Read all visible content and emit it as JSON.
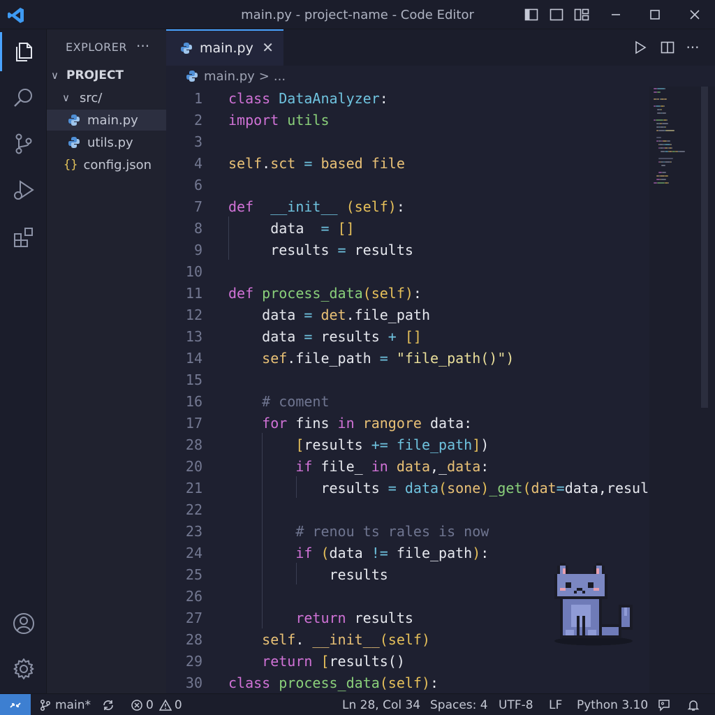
{
  "window": {
    "title": "main.py - project-name - Code Editor"
  },
  "sidebar": {
    "header": "EXPLORER",
    "more_label": "···",
    "tree": [
      {
        "label": "PROJECT",
        "chevron": "∨"
      },
      {
        "label": "src/",
        "chevron": "∨"
      },
      {
        "label": "main.py",
        "icon": "python-file-icon",
        "selected": true
      },
      {
        "label": "utils.py",
        "icon": "python-file-icon"
      },
      {
        "label": "config.json",
        "icon": "json-file-icon",
        "icon_glyph": "{}"
      }
    ]
  },
  "tabs": [
    {
      "label": "main.py",
      "active": true,
      "close": "✕"
    }
  ],
  "breadcrumb": {
    "file": "main.py",
    "separator": ">",
    "rest": "..."
  },
  "editor": {
    "lines": [
      {
        "n": "1",
        "tokens": [
          [
            "kw",
            "class "
          ],
          [
            "cls",
            "DataAnalyzer"
          ],
          [
            "txt",
            ":"
          ]
        ]
      },
      {
        "n": "2",
        "tokens": [
          [
            "kw",
            "import "
          ],
          [
            "fn",
            "utils"
          ]
        ]
      },
      {
        "n": "3",
        "tokens": []
      },
      {
        "n": "4",
        "tokens": [
          [
            "var",
            "self"
          ],
          [
            "txt",
            "."
          ],
          [
            "var",
            "sct"
          ],
          [
            "op",
            " = "
          ],
          [
            "var",
            "based "
          ],
          [
            "var",
            "file"
          ]
        ]
      },
      {
        "n": "6",
        "tokens": []
      },
      {
        "n": "7",
        "tokens": [
          [
            "kw",
            "def  "
          ],
          [
            "cls",
            "__init__ "
          ],
          [
            "par",
            "(self)"
          ],
          [
            "txt",
            ":"
          ]
        ]
      },
      {
        "n": "8",
        "tokens": [
          [
            "txt",
            "     data  "
          ],
          [
            "op",
            "= "
          ],
          [
            "par",
            "[]"
          ]
        ]
      },
      {
        "n": "9",
        "tokens": [
          [
            "txt",
            "     results "
          ],
          [
            "op",
            "= "
          ],
          [
            "txt",
            "results"
          ]
        ]
      },
      {
        "n": "10",
        "tokens": []
      },
      {
        "n": "11",
        "tokens": [
          [
            "kw",
            "def "
          ],
          [
            "fn",
            "process_data"
          ],
          [
            "par",
            "(self)"
          ],
          [
            "txt",
            ":"
          ]
        ]
      },
      {
        "n": "12",
        "tokens": [
          [
            "txt",
            "    data "
          ],
          [
            "op",
            "= "
          ],
          [
            "var",
            "det"
          ],
          [
            "txt",
            ".file_path"
          ]
        ]
      },
      {
        "n": "13",
        "tokens": [
          [
            "txt",
            "    data "
          ],
          [
            "op",
            "= "
          ],
          [
            "txt",
            "results "
          ],
          [
            "op",
            "+ "
          ],
          [
            "par",
            "[]"
          ]
        ]
      },
      {
        "n": "14",
        "tokens": [
          [
            "var",
            "    sef"
          ],
          [
            "txt",
            ".file_path "
          ],
          [
            "op",
            "= "
          ],
          [
            "str",
            "\"file_path()\")"
          ]
        ]
      },
      {
        "n": "15",
        "tokens": []
      },
      {
        "n": "16",
        "tokens": [
          [
            "cm",
            "    # coment"
          ]
        ]
      },
      {
        "n": "17",
        "tokens": [
          [
            "kw",
            "    for "
          ],
          [
            "txt",
            "fins "
          ],
          [
            "kw",
            "in "
          ],
          [
            "var",
            "rangore "
          ],
          [
            "txt",
            "data:"
          ]
        ]
      },
      {
        "n": "28",
        "tokens": [
          [
            "par",
            "        ["
          ],
          [
            "txt",
            "results "
          ],
          [
            "op",
            "+= "
          ],
          [
            "cls",
            "file_path"
          ],
          [
            "par",
            "]"
          ],
          [
            "txt",
            ")"
          ]
        ]
      },
      {
        "n": "20",
        "tokens": [
          [
            "kw",
            "        if "
          ],
          [
            "txt",
            "file_ "
          ],
          [
            "kw",
            "in "
          ],
          [
            "var",
            "data"
          ],
          [
            "txt",
            ",_"
          ],
          [
            "var",
            "data"
          ],
          [
            "txt",
            ":"
          ]
        ]
      },
      {
        "n": "21",
        "tokens": [
          [
            "txt",
            "           results "
          ],
          [
            "op",
            "= "
          ],
          [
            "cls",
            "data"
          ],
          [
            "par",
            "("
          ],
          [
            "var",
            "sone"
          ],
          [
            "par",
            ")"
          ],
          [
            "fn",
            "_get"
          ],
          [
            "par",
            "("
          ],
          [
            "var",
            "dat"
          ],
          [
            "op",
            "="
          ],
          [
            "txt",
            "data,resul"
          ]
        ]
      },
      {
        "n": "22",
        "tokens": []
      },
      {
        "n": "23",
        "tokens": [
          [
            "cm",
            "        # renou ts rales is now"
          ]
        ]
      },
      {
        "n": "24",
        "tokens": [
          [
            "kw",
            "        if "
          ],
          [
            "par",
            "("
          ],
          [
            "txt",
            "data "
          ],
          [
            "op",
            "!= "
          ],
          [
            "txt",
            "file_path"
          ],
          [
            "par",
            ")"
          ],
          [
            "txt",
            ":"
          ]
        ]
      },
      {
        "n": "25",
        "tokens": [
          [
            "txt",
            "            results"
          ]
        ]
      },
      {
        "n": "26",
        "tokens": []
      },
      {
        "n": "27",
        "tokens": [
          [
            "kw",
            "        return "
          ],
          [
            "txt",
            "results"
          ]
        ]
      },
      {
        "n": "28",
        "tokens": [
          [
            "var",
            "    self"
          ],
          [
            "txt",
            ". "
          ],
          [
            "var",
            "__init__"
          ],
          [
            "par",
            "(self)"
          ]
        ]
      },
      {
        "n": "29",
        "tokens": [
          [
            "kw",
            "    return "
          ],
          [
            "par",
            "["
          ],
          [
            "txt",
            "results()"
          ]
        ]
      },
      {
        "n": "30",
        "tokens": [
          [
            "kw",
            "class "
          ],
          [
            "fn",
            "process_data"
          ],
          [
            "par",
            "(self)"
          ],
          [
            "txt",
            ":"
          ]
        ]
      }
    ]
  },
  "statusbar": {
    "remote_icon": "remote-icon",
    "branch": "main*",
    "errors": "0",
    "warnings": "0",
    "position": "Ln 28, Col 34",
    "spaces": "Spaces: 4",
    "encoding": "UTF-8",
    "eol": "LF",
    "language": "Python 3.10"
  },
  "colors": {
    "accent": "#4aa3ff",
    "keyword": "#d072d6",
    "class": "#6fc3df",
    "function": "#8ad07a",
    "variable": "#e9c176",
    "comment": "#6f7590"
  }
}
